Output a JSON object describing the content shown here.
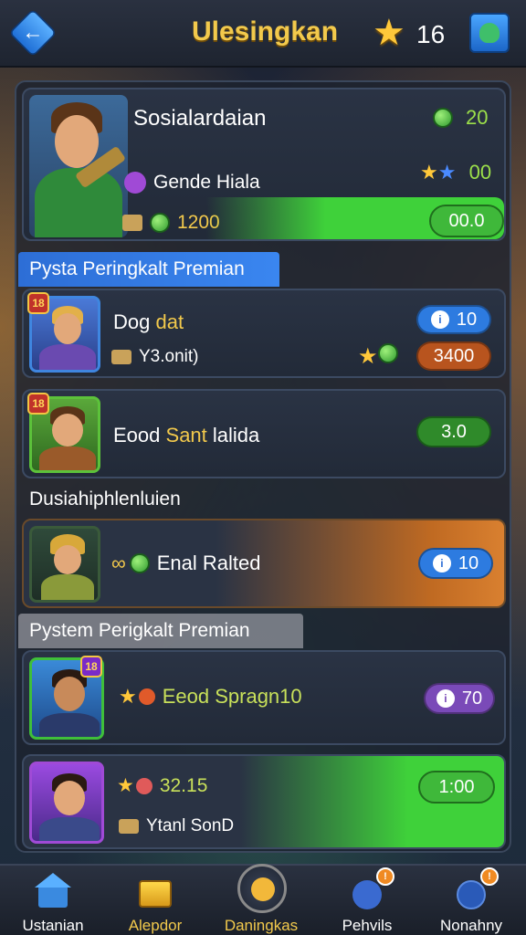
{
  "header": {
    "title": "Ulesingkan",
    "star_count": "16",
    "back_icon": "arrow-left-icon",
    "profile_icon": "user-icon"
  },
  "featured": {
    "name": "Sosialardaian",
    "subtitle": "Gende Hiala",
    "gems": "20",
    "stars": "00",
    "coins": "1200",
    "action_value": "00.0"
  },
  "sections": {
    "first": "Pysta Peringkalt Premian",
    "second": "Dusiahiphlenluien",
    "third": "Pystem Perigkalt Premian"
  },
  "rows": [
    {
      "name_a": "Dog",
      "name_b": "dat",
      "sub": "Y3.onit)",
      "pill": "10",
      "pill2": "3400",
      "badge": "18"
    },
    {
      "name_a": "Eood",
      "name_b": "Sant",
      "name_c": "lalida",
      "pill": "3.0",
      "badge": "18"
    },
    {
      "name": "Enal Ralted",
      "pill": "10"
    },
    {
      "name": "Eeod Spragn10",
      "pill": "70",
      "badge": "18"
    },
    {
      "value": "32.15",
      "sub": "Ytanl SonD",
      "pill": "1:00"
    }
  ],
  "nav": [
    {
      "label": "Ustanian",
      "icon": "home-icon"
    },
    {
      "label": "Alepdor",
      "icon": "chest-icon"
    },
    {
      "label": "Daningkas",
      "icon": "sword-icon"
    },
    {
      "label": "Pehvils",
      "icon": "rocket-icon"
    },
    {
      "label": "Nonahny",
      "icon": "shield-icon"
    }
  ],
  "colors": {
    "accent_blue": "#2d7be0",
    "accent_green": "#3fbf3a",
    "accent_orange": "#d97a22",
    "gold": "#f2c94c"
  }
}
